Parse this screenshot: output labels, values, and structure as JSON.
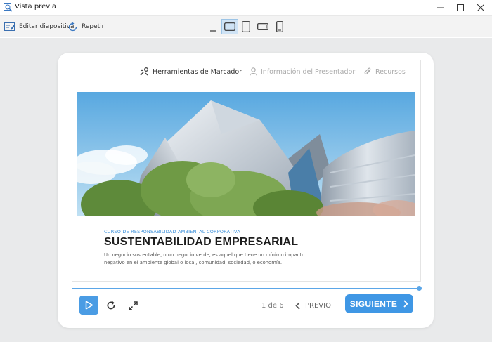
{
  "window": {
    "title": "Vista previa"
  },
  "toolbar": {
    "edit_label": "Editar diapositiva",
    "repeat_label": "Repetir",
    "devices": [
      "desktop",
      "tablet-landscape",
      "tablet-portrait",
      "phone-landscape",
      "phone-portrait"
    ],
    "active_device": "tablet-landscape"
  },
  "slide": {
    "nav": {
      "tools": "Herramientas de Marcador",
      "presenter": "Información del Presentador",
      "resources": "Recursos"
    },
    "course_label": "CURSO DE RESPONSABILIDAD AMBIENTAL CORPORATIVA",
    "title": "SUSTENTABILIDAD EMPRESARIAL",
    "description": "Un negocio sustentable, o un negocio verde, es aquel que tiene un mínimo impacto negativo en el ambiente global o local, comunidad, sociedad, o economía."
  },
  "player": {
    "progress": 1.0,
    "page_counter": "1 de 6",
    "prev_label": "PREVIO",
    "next_label": "SIGUIENTE"
  },
  "colors": {
    "accent": "#3f97e5",
    "canvas_bg": "#e9eaeb",
    "course_label": "#3b8fd9"
  }
}
